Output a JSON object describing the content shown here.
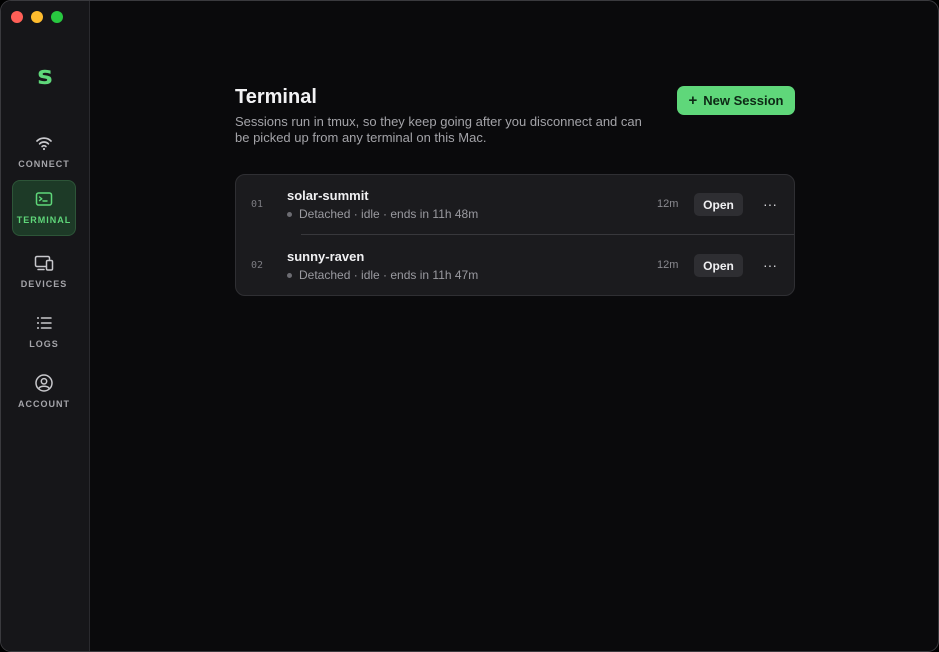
{
  "app": {
    "logo_letter": "s"
  },
  "sidebar": {
    "items": [
      {
        "id": "connect",
        "label": "CONNECT",
        "icon": "wifi-icon",
        "active": false
      },
      {
        "id": "terminal",
        "label": "TERMINAL",
        "icon": "terminal-icon",
        "active": true
      },
      {
        "id": "devices",
        "label": "DEVICES",
        "icon": "devices-icon",
        "active": false
      },
      {
        "id": "logs",
        "label": "LOGS",
        "icon": "list-icon",
        "active": false
      },
      {
        "id": "account",
        "label": "ACCOUNT",
        "icon": "user-circle-icon",
        "active": false
      }
    ]
  },
  "main": {
    "title": "Terminal",
    "description": "Sessions run in tmux, so they keep going after you disconnect and can be picked up from any terminal on this Mac.",
    "new_session_label": "New Session",
    "new_session_icon": "plus-icon",
    "sessions": [
      {
        "index": "01",
        "name": "solar-summit",
        "meta": "Detached · idle · ends in 11h 48m",
        "age": "12m",
        "open_label": "Open",
        "more": "···"
      },
      {
        "index": "02",
        "name": "sunny-raven",
        "meta": "Detached · idle · ends in 11h 47m",
        "age": "12m",
        "open_label": "Open",
        "more": "···"
      }
    ]
  },
  "colors": {
    "accent": "#5fd77a",
    "sidebar_bg": "#161619",
    "content_bg": "#0a0a0c",
    "card_bg": "#1b1b1e",
    "active_nav_bg": "#1d3a27"
  }
}
